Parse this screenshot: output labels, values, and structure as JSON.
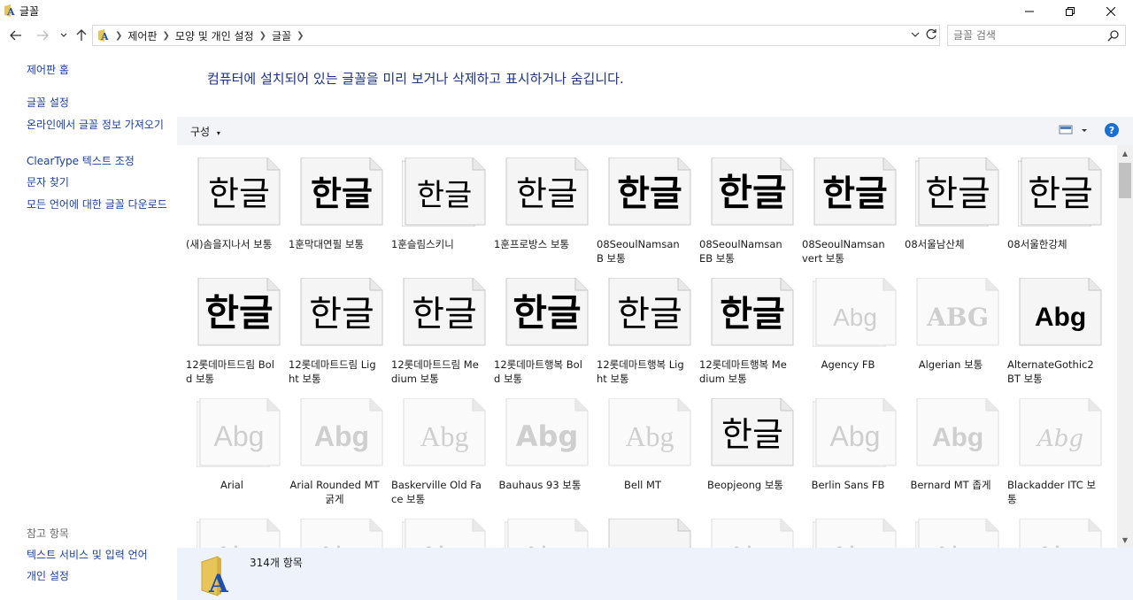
{
  "window": {
    "title": "글꼴",
    "icons": {
      "minimize": "minimize-icon",
      "maximize": "restore-icon",
      "close": "close-icon"
    }
  },
  "address": {
    "breadcrumbs": [
      "제어판",
      "모양 및 개인 설정",
      "글꼴"
    ],
    "search_placeholder": "글꼴 검색"
  },
  "sidebar": {
    "home": "제어판 홈",
    "links": [
      "글꼴 설정",
      "온라인에서 글꼴 정보 가져오기",
      "ClearType 텍스트 조정",
      "문자 찾기",
      "모든 언어에 대한 글꼴 다운로드"
    ],
    "see_also_heading": "참고 항목",
    "see_also": [
      "텍스트 서비스 및 입력 언어",
      "개인 설정"
    ]
  },
  "main": {
    "header": "컴퓨터에 설치되어 있는 글꼴을 미리 보거나 삭제하고 표시하거나 숨깁니다.",
    "organize": "구성",
    "help": "?"
  },
  "fonts": [
    {
      "name": "(새)솜을지나서 보통",
      "preview": "한글",
      "style": "brush",
      "active": true,
      "stack": false
    },
    {
      "name": "1훈막대연필 보통",
      "preview": "한글",
      "style": "brush-bold",
      "active": true,
      "stack": false
    },
    {
      "name": "1훈슬림스키니",
      "preview": "한글",
      "style": "thin",
      "active": true,
      "stack": true
    },
    {
      "name": "1훈프로방스 보통",
      "preview": "한글",
      "style": "brush",
      "active": true,
      "stack": false
    },
    {
      "name": "08SeoulNamsan B 보통",
      "preview": "한글",
      "style": "bold",
      "active": true,
      "stack": false
    },
    {
      "name": "08SeoulNamsan EB 보통",
      "preview": "한글",
      "style": "xbold",
      "active": true,
      "stack": false
    },
    {
      "name": "08SeoulNamsan vert 보통",
      "preview": "한글",
      "style": "bold",
      "active": true,
      "stack": false
    },
    {
      "name": "08서울남산체",
      "preview": "한글",
      "style": "regular",
      "active": true,
      "stack": true
    },
    {
      "name": "08서울한강체",
      "preview": "한글",
      "style": "regular",
      "active": true,
      "stack": true
    },
    {
      "name": "12롯데마트드림 Bold 보통",
      "preview": "한글",
      "style": "xbold",
      "active": true,
      "stack": false
    },
    {
      "name": "12롯데마트드림 Light 보통",
      "preview": "한글",
      "style": "light",
      "active": true,
      "stack": false
    },
    {
      "name": "12롯데마트드림 Medium 보통",
      "preview": "한글",
      "style": "regular",
      "active": true,
      "stack": false
    },
    {
      "name": "12롯데마트행복 Bold 보통",
      "preview": "한글",
      "style": "xbold",
      "active": true,
      "stack": false
    },
    {
      "name": "12롯데마트행복 Light 보통",
      "preview": "한글",
      "style": "regular",
      "active": true,
      "stack": false
    },
    {
      "name": "12롯데마트행복 Medium 보통",
      "preview": "한글",
      "style": "bold",
      "active": true,
      "stack": false
    },
    {
      "name": "Agency FB",
      "preview": "Abg",
      "style": "condensed",
      "active": false,
      "stack": true,
      "center": true
    },
    {
      "name": "Algerian 보통",
      "preview": "ABG",
      "style": "serif-caps",
      "active": false,
      "stack": false,
      "center": true
    },
    {
      "name": "AlternateGothic2 BT 보통",
      "preview": "Abg",
      "style": "condensed-bold",
      "active": true,
      "stack": false
    },
    {
      "name": "Arial",
      "preview": "Abg",
      "style": "sans",
      "active": false,
      "stack": true,
      "center": true
    },
    {
      "name": "Arial Rounded MT 굵게",
      "preview": "Abg",
      "style": "sans-bold",
      "active": false,
      "stack": false,
      "center": true
    },
    {
      "name": "Baskerville Old Face 보통",
      "preview": "Abg",
      "style": "serif",
      "active": false,
      "stack": false
    },
    {
      "name": "Bauhaus 93 보통",
      "preview": "Abg",
      "style": "heavy",
      "active": false,
      "stack": false,
      "center": true
    },
    {
      "name": "Bell MT",
      "preview": "Abg",
      "style": "serif",
      "active": false,
      "stack": false,
      "center": true
    },
    {
      "name": "Beopjeong 보통",
      "preview": "한글",
      "style": "brush",
      "active": true,
      "stack": false,
      "center": true
    },
    {
      "name": "Berlin Sans FB",
      "preview": "Abg",
      "style": "sans",
      "active": false,
      "stack": true,
      "center": true
    },
    {
      "name": "Bernard MT 좁게",
      "preview": "Abg",
      "style": "condensed-bold",
      "active": false,
      "stack": false,
      "center": true
    },
    {
      "name": "Blackadder ITC 보통",
      "preview": "Abg",
      "style": "script",
      "active": false,
      "stack": false
    },
    {
      "name": "",
      "preview": "Abg",
      "style": "sans",
      "active": false,
      "stack": true
    },
    {
      "name": "",
      "preview": "Abg",
      "style": "sans",
      "active": false,
      "stack": false
    },
    {
      "name": "",
      "preview": "Abg",
      "style": "sans",
      "active": false,
      "stack": true
    },
    {
      "name": "",
      "preview": "Abg",
      "style": "sans",
      "active": false,
      "stack": true
    },
    {
      "name": "",
      "preview": "Abg",
      "style": "script",
      "active": true,
      "stack": false
    },
    {
      "name": "",
      "preview": "Abg",
      "style": "sans",
      "active": false,
      "stack": false
    },
    {
      "name": "",
      "preview": "Abg",
      "style": "sans",
      "active": false,
      "stack": true
    },
    {
      "name": "",
      "preview": "Abg",
      "style": "sans",
      "active": false,
      "stack": true
    },
    {
      "name": "",
      "preview": "Abg",
      "style": "sans",
      "active": false,
      "stack": false
    }
  ],
  "status": {
    "count": "314개 항목"
  }
}
